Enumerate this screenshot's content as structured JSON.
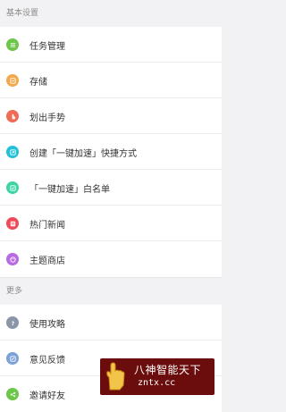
{
  "sections": [
    {
      "header": "基本设置",
      "items": [
        {
          "label": "任务管理",
          "icon": "task-list-icon",
          "color": "#6cc64a"
        },
        {
          "label": "存储",
          "icon": "storage-icon",
          "color": "#f3a84c"
        },
        {
          "label": "划出手势",
          "icon": "gesture-icon",
          "color": "#f06b55"
        },
        {
          "label": "创建「一键加速」快捷方式",
          "icon": "shortcut-icon",
          "color": "#23c1d6"
        },
        {
          "label": "「一键加速」白名单",
          "icon": "whitelist-icon",
          "color": "#3dd5a6"
        },
        {
          "label": "热门新闻",
          "icon": "news-icon",
          "color": "#f04a5a"
        },
        {
          "label": "主题商店",
          "icon": "theme-store-icon",
          "color": "#b86be0"
        }
      ]
    },
    {
      "header": "更多",
      "items": [
        {
          "label": "使用攻略",
          "icon": "help-icon",
          "color": "#8b95a8"
        },
        {
          "label": "意见反馈",
          "icon": "feedback-icon",
          "color": "#7aa1d8"
        },
        {
          "label": "邀请好友",
          "icon": "share-icon",
          "color": "#6cc64a"
        }
      ]
    }
  ],
  "watermark": {
    "title": "八神智能天下",
    "domain": "zntx.cc"
  }
}
